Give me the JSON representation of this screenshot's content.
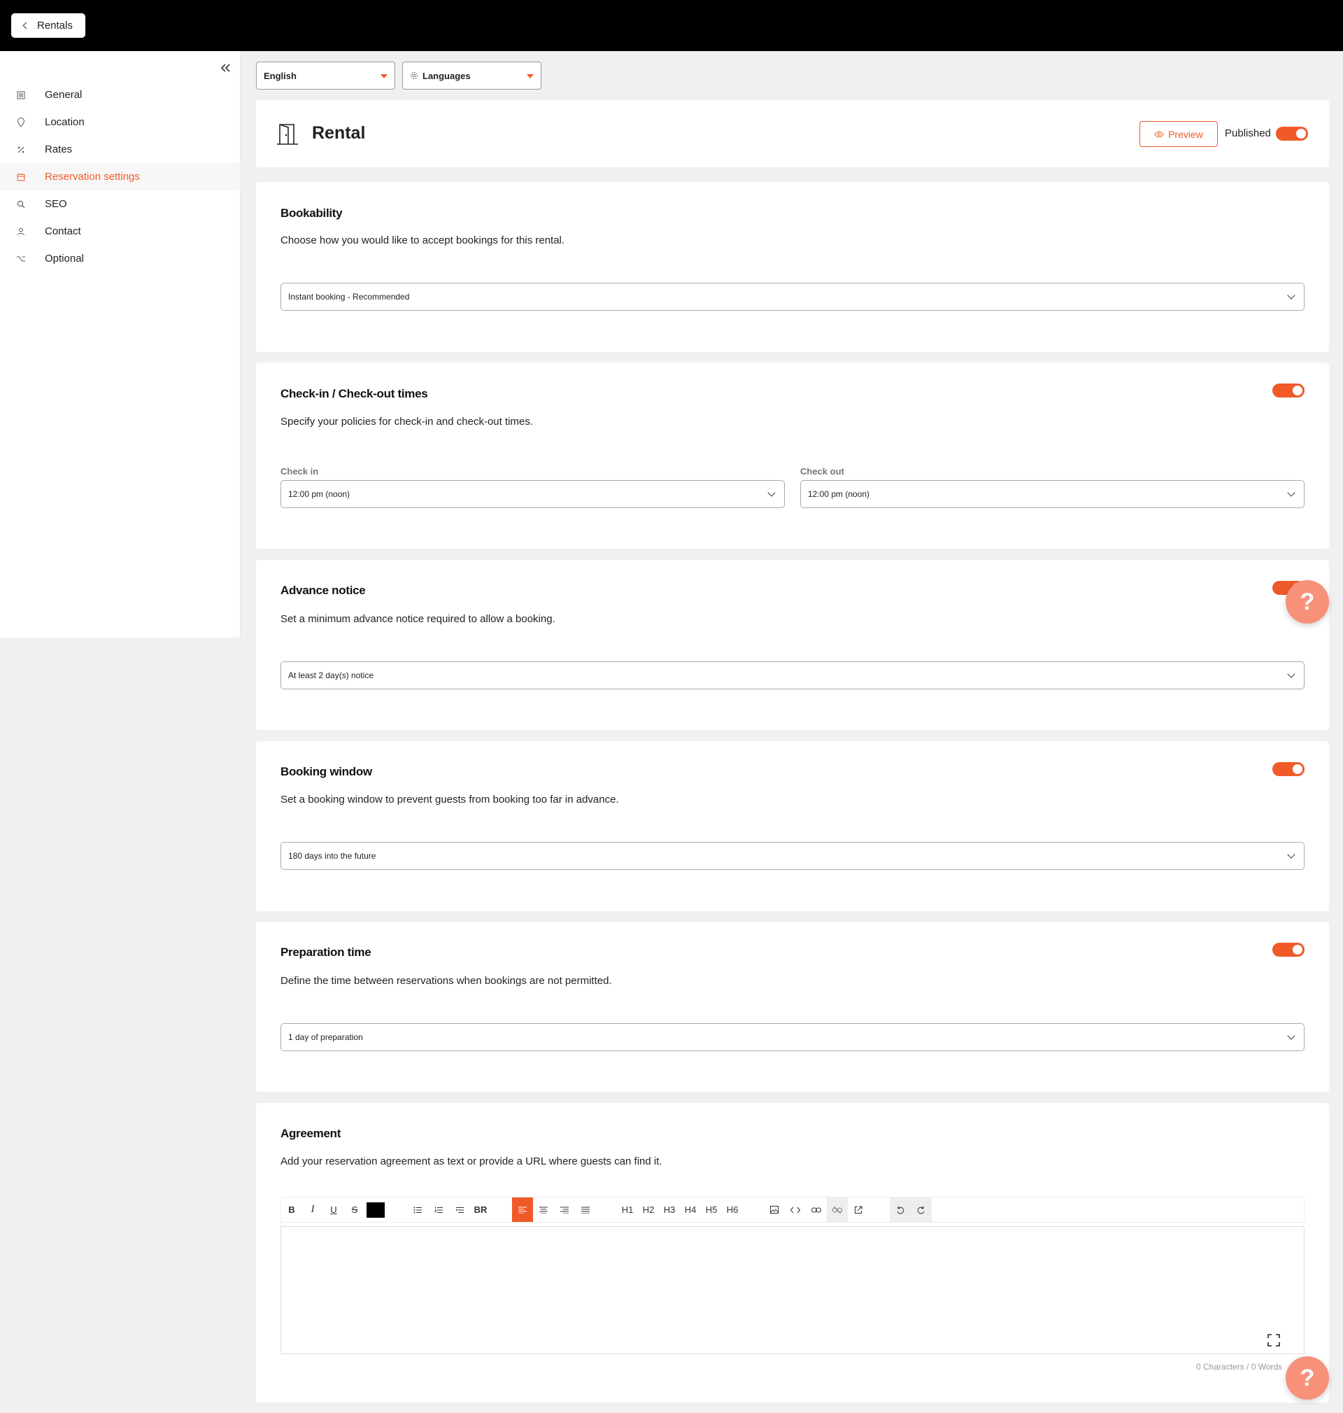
{
  "topbar": {
    "back_label": "Rentals"
  },
  "sidebar": {
    "items": [
      {
        "label": "General",
        "icon": "document-icon",
        "active": false
      },
      {
        "label": "Location",
        "icon": "pin-icon",
        "active": false
      },
      {
        "label": "Rates",
        "icon": "percent-icon",
        "active": false
      },
      {
        "label": "Reservation settings",
        "icon": "calendar-icon",
        "active": true
      },
      {
        "label": "SEO",
        "icon": "search-icon",
        "active": false
      },
      {
        "label": "Contact",
        "icon": "person-icon",
        "active": false
      },
      {
        "label": "Optional",
        "icon": "option-icon",
        "active": false
      }
    ]
  },
  "language": {
    "selected": "English",
    "languages_label": "Languages"
  },
  "header": {
    "title": "Rental",
    "preview_label": "Preview",
    "published_label": "Published",
    "published": true
  },
  "bookability": {
    "title": "Bookability",
    "description": "Choose how you would like to accept bookings for this rental.",
    "value": "Instant booking - Recommended"
  },
  "checkin": {
    "title": "Check-in / Check-out times",
    "description": "Specify your policies for check-in and check-out times.",
    "enabled": true,
    "checkin_label": "Check in",
    "checkin_value": "12:00 pm (noon)",
    "checkout_label": "Check out",
    "checkout_value": "12:00 pm (noon)"
  },
  "advance": {
    "title": "Advance notice",
    "description": "Set a minimum advance notice required to allow a booking.",
    "enabled": true,
    "value": "At least 2 day(s) notice"
  },
  "window": {
    "title": "Booking window",
    "description": "Set a booking window to prevent guests from booking too far in advance.",
    "enabled": true,
    "value": "180 days into the future"
  },
  "preparation": {
    "title": "Preparation time",
    "description": "Define the time between reservations when bookings are not permitted.",
    "enabled": true,
    "value": "1 day of preparation"
  },
  "agreement": {
    "title": "Agreement",
    "description": "Add your reservation agreement as text or provide a URL where guests can find it.",
    "toolbar": {
      "bold": "B",
      "italic": "I",
      "underline": "U",
      "strike": "S",
      "br": "BR",
      "h1": "H1",
      "h2": "H2",
      "h3": "H3",
      "h4": "H4",
      "h5": "H5",
      "h6": "H6"
    },
    "counter": "0 Characters / 0 Words"
  },
  "help": {
    "label": "?"
  },
  "colors": {
    "accent": "#f05a28",
    "help_bg": "#f7917a",
    "topbar": "#000000"
  }
}
